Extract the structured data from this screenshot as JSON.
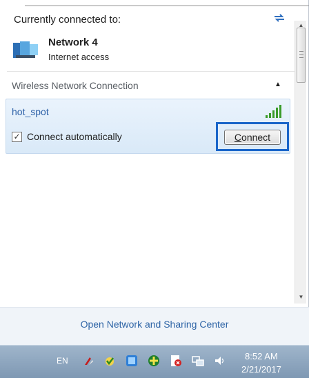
{
  "header": {
    "title": "Currently connected to:",
    "network_name": "Network  4",
    "network_status": "Internet access"
  },
  "section": {
    "title": "Wireless Network Connection"
  },
  "network_item": {
    "ssid": "hot_spot",
    "auto_connect_label": "Connect automatically",
    "auto_connect_checked": true,
    "connect_label_first": "C",
    "connect_label_rest": "onnect"
  },
  "footer": {
    "link": "Open Network and Sharing Center"
  },
  "taskbar": {
    "language": "EN",
    "time": "8:52 AM",
    "date": "2/21/2017",
    "icons": [
      "flag-icon",
      "security-icon",
      "network-tool-icon",
      "update-icon",
      "alert-icon",
      "network-icon",
      "volume-icon"
    ]
  },
  "colors": {
    "accent": "#1965c9",
    "link": "#2e64a6",
    "selected_row": "#dceaf8"
  }
}
